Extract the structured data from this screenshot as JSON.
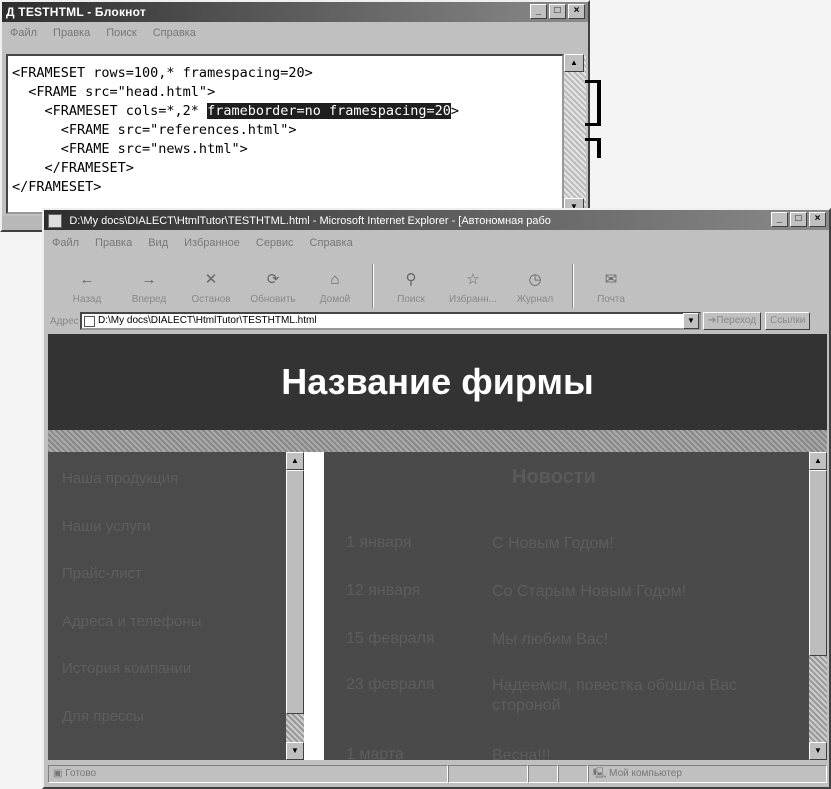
{
  "notepad": {
    "title": "Д TESTHTML - Блокнот",
    "menu": [
      "Файл",
      "Правка",
      "Поиск",
      "Справка"
    ],
    "lines": [
      "<FRAMESET rows=100,* framespacing=20>",
      "  <FRAME src=\"head.html\">",
      "    <FRAMESET cols=*,2* ",
      "      <FRAME src=\"references.html\">",
      "      <FRAME src=\"news.html\">",
      "    </FRAMESET>",
      "</FRAMESET>"
    ],
    "line3_highlight": "frameborder=no framespacing=20",
    "line3_suffix": ">"
  },
  "ie": {
    "title": "D:\\My docs\\DIALECT\\HtmlTutor\\TESTHTML.html - Microsoft Internet Explorer - [Автономная рабо",
    "menu": [
      "Файл",
      "Правка",
      "Вид",
      "Избранное",
      "Сервис",
      "Справка"
    ],
    "toolbar": [
      {
        "label": "Назад",
        "icon": "back-arrow-icon",
        "glyph": "←"
      },
      {
        "label": "Вперед",
        "icon": "forward-arrow-icon",
        "glyph": "→"
      },
      {
        "label": "Останов",
        "icon": "stop-icon",
        "glyph": "✕"
      },
      {
        "label": "Обновить",
        "icon": "refresh-icon",
        "glyph": "⟳"
      },
      {
        "label": "Домой",
        "icon": "home-icon",
        "glyph": "⌂"
      },
      {
        "label": "Поиск",
        "icon": "search-icon",
        "glyph": "⚲"
      },
      {
        "label": "Избранн...",
        "icon": "favorites-icon",
        "glyph": "☆"
      },
      {
        "label": "Журнал",
        "icon": "history-icon",
        "glyph": "◷"
      },
      {
        "label": "Почта",
        "icon": "mail-icon",
        "glyph": "✉"
      }
    ],
    "address_label": "Адрес",
    "address": "D:\\My docs\\DIALECT\\HtmlTutor\\TESTHTML.html",
    "go_label": "Переход",
    "links_label": "Ссылки",
    "status": {
      "text": "Готово",
      "zone": "Мой компьютер"
    }
  },
  "page": {
    "heading": "Название фирмы",
    "nav_links": [
      "Наша продукция",
      "Наши услуги",
      "Прайс-лист",
      "Адреса и телефоны",
      "История компании",
      "Для прессы"
    ],
    "news_title": "Новости",
    "news": [
      {
        "date": "1 января",
        "text": "С Новым Годом!"
      },
      {
        "date": "12 января",
        "text": "Со Старым Новым Годом!"
      },
      {
        "date": "15 февраля",
        "text": "Мы любим Вас!"
      },
      {
        "date": "23 февраля",
        "text": "Надеемся, повестка обошла Вас стороной"
      },
      {
        "date": "1 марта",
        "text": "Весна!!!"
      }
    ]
  }
}
